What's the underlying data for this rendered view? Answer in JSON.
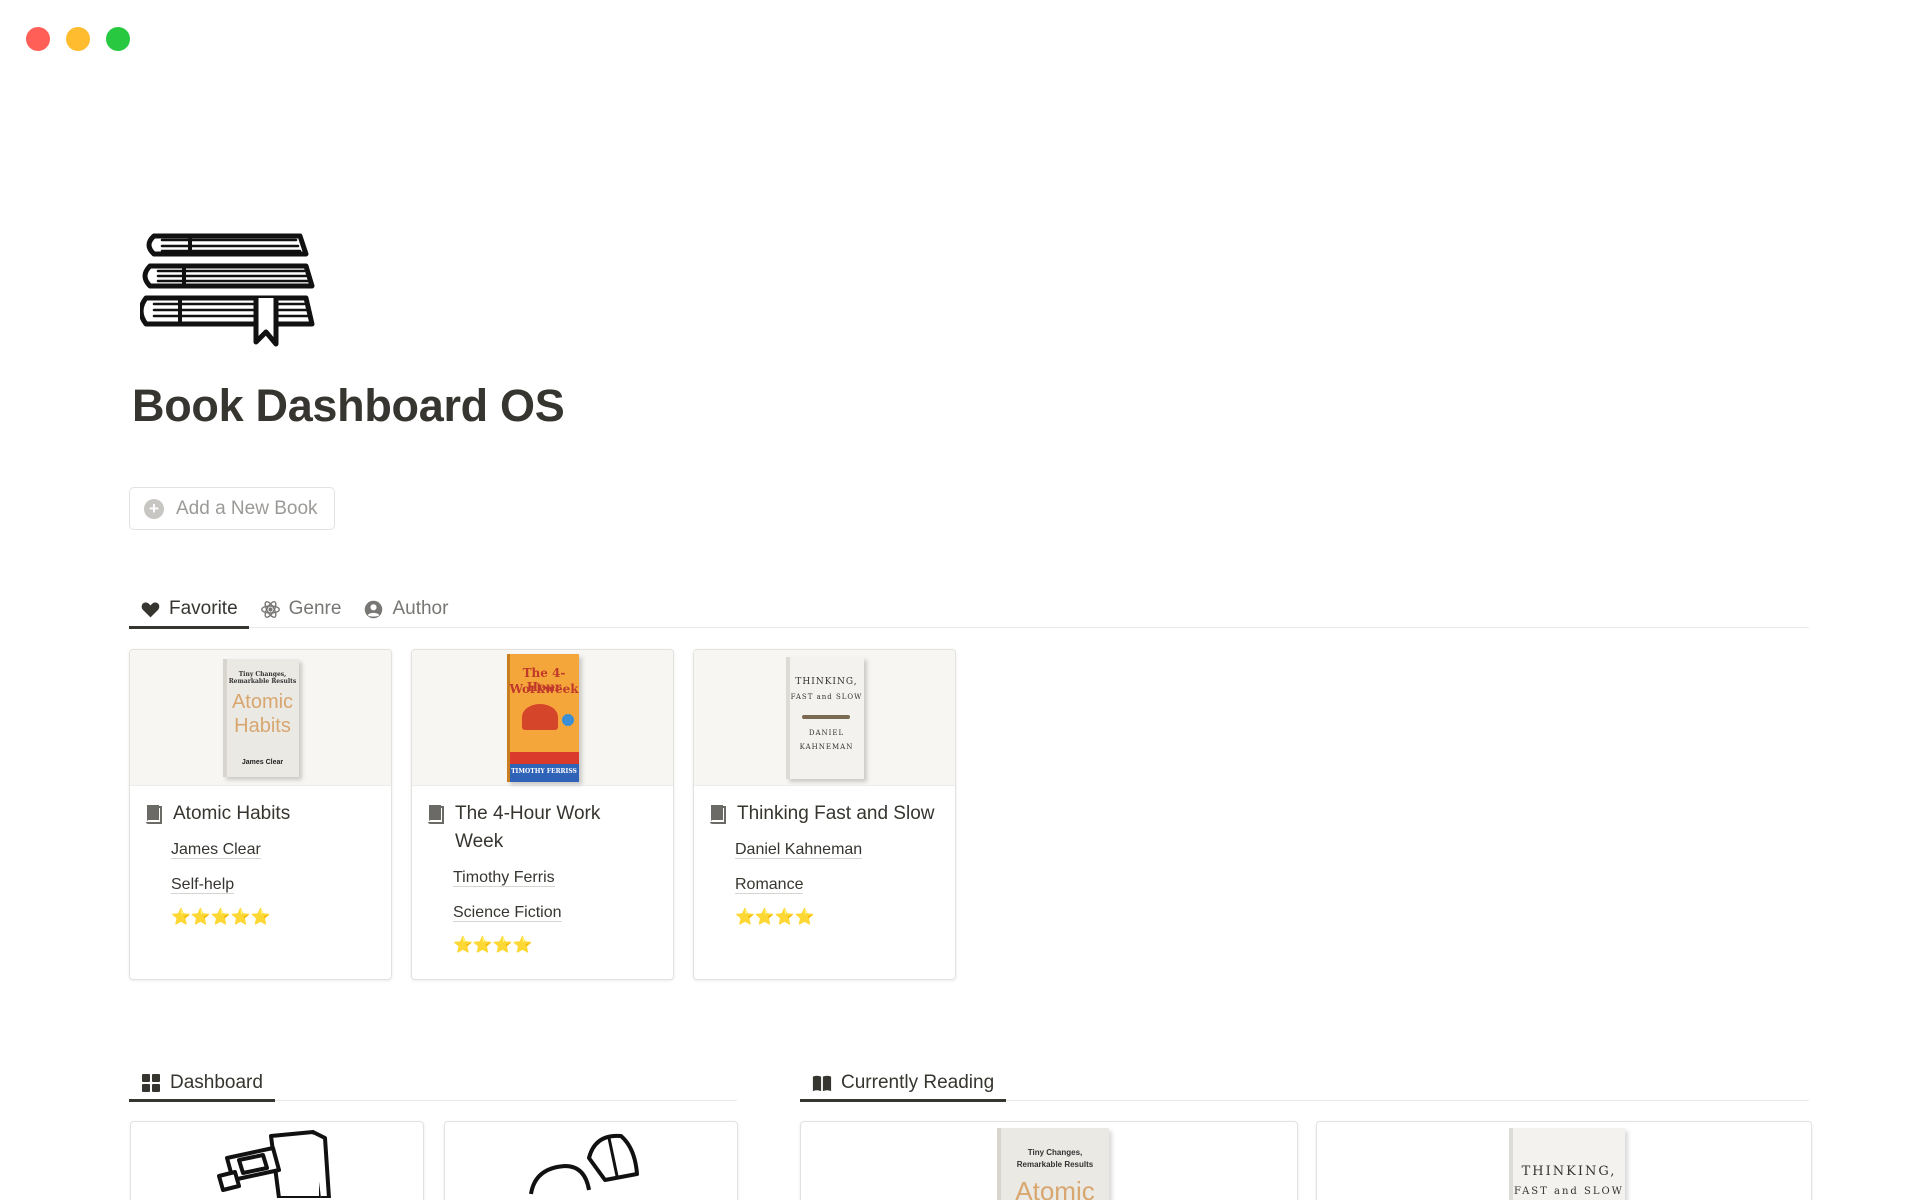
{
  "window": {
    "controls": [
      "close",
      "minimize",
      "zoom"
    ]
  },
  "page": {
    "icon": "books-icon",
    "title": "Book Dashboard OS"
  },
  "add_button": {
    "label": "Add a New Book",
    "icon": "plus-circle-icon"
  },
  "tabs": [
    {
      "label": "Favorite",
      "icon": "heart-icon",
      "active": true
    },
    {
      "label": "Genre",
      "icon": "atom-icon",
      "active": false
    },
    {
      "label": "Author",
      "icon": "user-circle-icon",
      "active": false
    }
  ],
  "books": [
    {
      "title": "Atomic Habits",
      "author": "James Clear",
      "genre": "Self-help",
      "rating": 5,
      "stars": "⭐⭐⭐⭐⭐",
      "cover": {
        "line1": "Tiny Changes,",
        "line2": "Remarkable Results",
        "big1": "Atomic",
        "big2": "Habits",
        "byline": "James Clear"
      }
    },
    {
      "title": "The 4-Hour Work Week",
      "author": "Timothy Ferris",
      "genre": "Science Fiction",
      "rating": 4,
      "stars": "⭐⭐⭐⭐",
      "cover": {
        "big1": "The 4-Hour",
        "big2": "Workweek",
        "byline": "TIMOTHY FERRISS"
      }
    },
    {
      "title": "Thinking Fast and Slow",
      "author": "Daniel Kahneman",
      "genre": "Romance",
      "rating": 4,
      "stars": "⭐⭐⭐⭐",
      "cover": {
        "big1": "THINKING,",
        "big2": "FAST and SLOW",
        "byline1": "DANIEL",
        "byline2": "KAHNEMAN"
      }
    }
  ],
  "sections": {
    "dashboard": {
      "label": "Dashboard",
      "icon": "grid-icon"
    },
    "currently_reading": {
      "label": "Currently Reading",
      "icon": "open-book-icon"
    }
  },
  "bottom_covers": {
    "atomic": {
      "line1": "Tiny Changes,",
      "line2": "Remarkable Results",
      "big": "Atomic"
    },
    "thinking": {
      "big1": "THINKING,",
      "big2": "FAST and SLOW"
    }
  },
  "colors": {
    "accent": "#37352f",
    "muted": "#787774",
    "star": "#f4c430",
    "close": "#ff5f57",
    "minimize": "#febc2e",
    "zoom": "#28c840"
  }
}
